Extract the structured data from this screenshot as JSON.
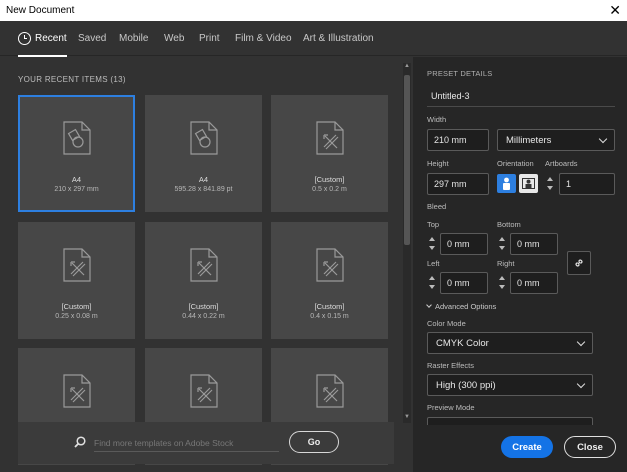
{
  "window": {
    "title": "New Document",
    "close_symbol": "✕"
  },
  "tabs": [
    {
      "label": "Recent",
      "active": true
    },
    {
      "label": "Saved"
    },
    {
      "label": "Mobile"
    },
    {
      "label": "Web"
    },
    {
      "label": "Print"
    },
    {
      "label": "Film & Video"
    },
    {
      "label": "Art & Illustration"
    }
  ],
  "recent": {
    "title": "YOUR RECENT ITEMS  (13)",
    "items": [
      {
        "name": "A4",
        "dims": "210 x 297 mm",
        "icon": "artboard-shapes-icon",
        "selected": true
      },
      {
        "name": "A4",
        "dims": "595.28 x 841.89 pt",
        "icon": "artboard-shapes-icon"
      },
      {
        "name": "[Custom]",
        "dims": "0.5 x 0.2 m",
        "icon": "custom-document-icon"
      },
      {
        "name": "[Custom]",
        "dims": "0.25 x 0.08 m",
        "icon": "custom-document-icon"
      },
      {
        "name": "[Custom]",
        "dims": "0.44 x 0.22 m",
        "icon": "custom-document-icon"
      },
      {
        "name": "[Custom]",
        "dims": "0.4 x 0.15 m",
        "icon": "custom-document-icon"
      },
      {
        "name": "",
        "dims": "",
        "icon": "custom-document-icon"
      },
      {
        "name": "",
        "dims": "",
        "icon": "custom-document-icon"
      },
      {
        "name": "",
        "dims": "",
        "icon": "custom-document-icon"
      }
    ]
  },
  "search": {
    "placeholder": "Find more templates on Adobe Stock",
    "go_label": "Go"
  },
  "preset": {
    "title": "PRESET DETAILS",
    "name": "Untitled-3",
    "width_label": "Width",
    "width_value": "210 mm",
    "units_value": "Millimeters",
    "height_label": "Height",
    "height_value": "297 mm",
    "orientation_label": "Orientation",
    "artboards_label": "Artboards",
    "artboards_value": "1",
    "bleed_label": "Bleed",
    "top_label": "Top",
    "top_value": "0 mm",
    "bottom_label": "Bottom",
    "bottom_value": "0 mm",
    "left_label": "Left",
    "left_value": "0 mm",
    "right_label": "Right",
    "right_value": "0 mm",
    "advanced_label": "Advanced Options",
    "color_mode_label": "Color Mode",
    "color_mode_value": "CMYK Color",
    "raster_label": "Raster Effects",
    "raster_value": "High (300 ppi)",
    "preview_label": "Preview Mode"
  },
  "actions": {
    "create": "Create",
    "close": "Close"
  },
  "colors": {
    "accent": "#1473e6",
    "selection": "#2d7fe0",
    "panel": "#262626",
    "background": "#323232",
    "card": "#474747"
  }
}
